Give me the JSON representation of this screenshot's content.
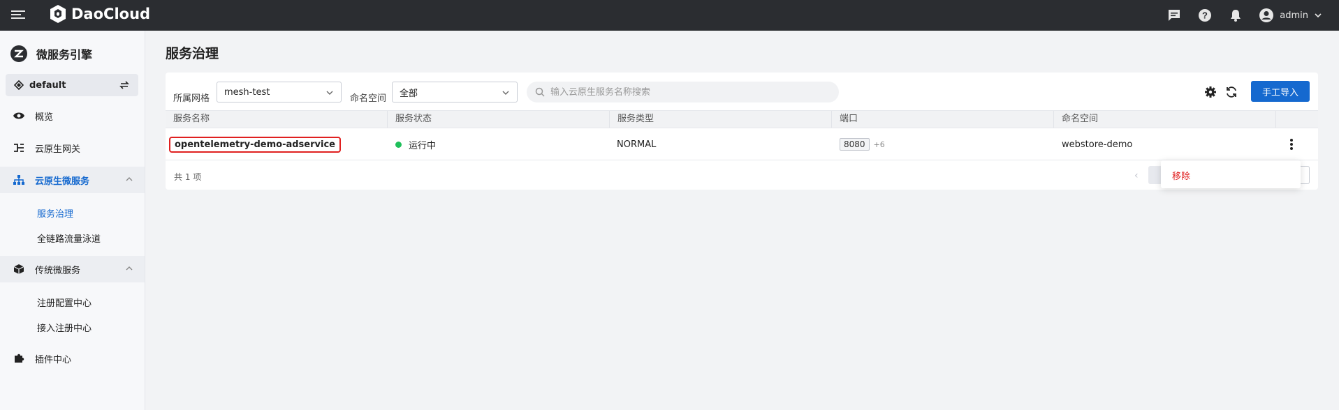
{
  "app": {
    "brand": "DaoCloud",
    "user": "admin"
  },
  "sidebar": {
    "title": "微服务引擎",
    "workspace": "default",
    "items": [
      {
        "label": "概览"
      },
      {
        "label": "云原生网关"
      },
      {
        "label": "云原生微服务",
        "sub": [
          {
            "label": "服务治理"
          },
          {
            "label": "全链路流量泳道"
          }
        ]
      },
      {
        "label": "传统微服务",
        "sub": [
          {
            "label": "注册配置中心"
          },
          {
            "label": "接入注册中心"
          }
        ]
      },
      {
        "label": "插件中心"
      }
    ]
  },
  "main": {
    "title": "服务治理",
    "filters": {
      "mesh_label": "所属网格",
      "mesh_value": "mesh-test",
      "ns_label": "命名空间",
      "ns_value": "全部",
      "search_placeholder": "输入云原生服务名称搜索"
    },
    "import_button": "手工导入",
    "table": {
      "headers": [
        "服务名称",
        "服务状态",
        "服务类型",
        "端口",
        "命名空间"
      ],
      "rows": [
        {
          "name": "opentelemetry-demo-adservice",
          "status": "运行中",
          "type": "NORMAL",
          "port": "8080",
          "port_more": "+6",
          "namespace": "webstore-demo"
        }
      ]
    },
    "total": "共 1 项",
    "row_menu": {
      "remove": "移除"
    }
  },
  "colors": {
    "primary": "#1569cf",
    "topbar": "#2b2d31",
    "running": "#1fbf5a",
    "danger": "#e02020"
  }
}
